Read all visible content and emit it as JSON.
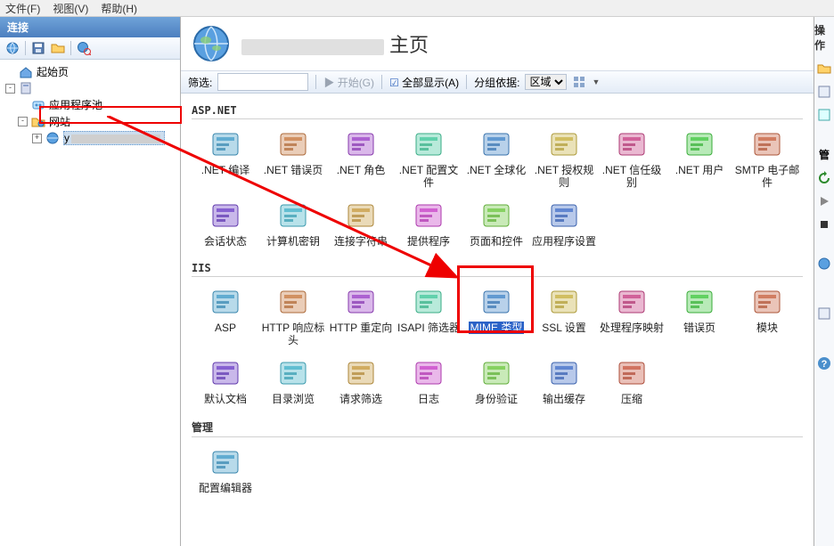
{
  "menubar": {
    "file": "文件(F)",
    "view": "视图(V)",
    "help": "帮助(H)"
  },
  "left": {
    "title": "连接",
    "tree": {
      "start": "起始页",
      "server": "",
      "apppools": "应用程序池",
      "sites": "网站",
      "site1": "y"
    }
  },
  "center": {
    "title_suffix": "主页",
    "filter_label": "筛选:",
    "filter_placeholder": "",
    "go_label": "开始(G)",
    "showall": "全部显示(A)",
    "groupby_label": "分组依据:",
    "groupby_value": "区域",
    "groups": {
      "aspnet": "ASP.NET",
      "iis": "IIS",
      "mgmt": "管理"
    },
    "aspnet_items": [
      ".NET 编译",
      ".NET 错误页",
      ".NET 角色",
      ".NET 配置文件",
      ".NET 全球化",
      ".NET 授权规则",
      ".NET 信任级别",
      ".NET 用户",
      "SMTP 电子邮件",
      "会话状态",
      "计算机密钥",
      "连接字符串",
      "提供程序",
      "页面和控件",
      "应用程序设置"
    ],
    "iis_items": [
      "ASP",
      "HTTP 响应标头",
      "HTTP 重定向",
      "ISAPI 筛选器",
      "MIME 类型",
      "SSL 设置",
      "处理程序映射",
      "错误页",
      "模块",
      "默认文档",
      "目录浏览",
      "请求筛选",
      "日志",
      "身份验证",
      "输出缓存",
      "压缩"
    ],
    "mgmt_items": [
      "配置编辑器"
    ],
    "selected_index_iis": 4
  },
  "right": {
    "title": "操作"
  },
  "colors": {
    "accent": "#2b62c7",
    "highlight_red": "#e00"
  }
}
